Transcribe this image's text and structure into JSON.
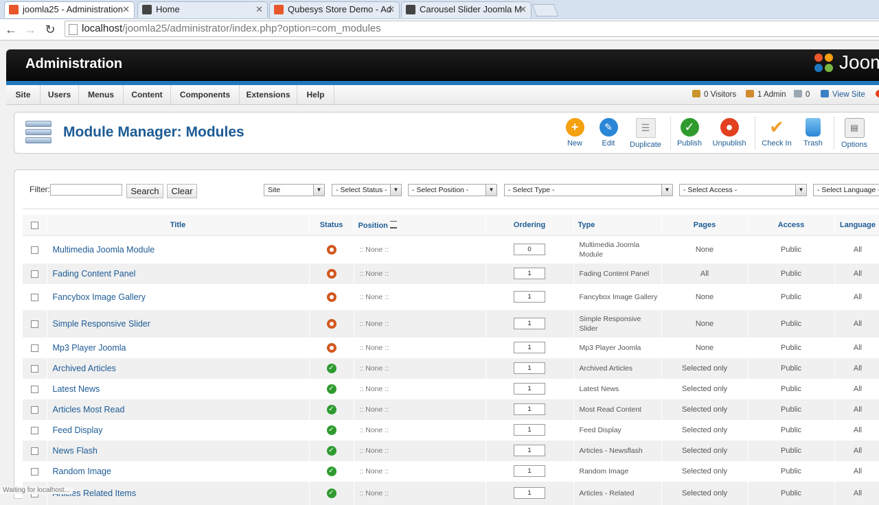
{
  "browser": {
    "tabs": [
      {
        "label": "joomla25 - Administration",
        "active": true
      },
      {
        "label": "Home",
        "active": false
      },
      {
        "label": "Qubesys Store Demo - Ad",
        "active": false
      },
      {
        "label": "Carousel Slider Joomla M",
        "active": false
      }
    ],
    "url_host": "localhost",
    "url_path": "/joomla25/administrator/index.php?option=com_modules",
    "status": "Waiting for localhost..."
  },
  "header": {
    "title": "Administration",
    "logo_text": "Joom"
  },
  "menu": [
    "Site",
    "Users",
    "Menus",
    "Content",
    "Components",
    "Extensions",
    "Help"
  ],
  "status_bar": {
    "visitors": "0 Visitors",
    "admins": "1 Admin",
    "messages": "0",
    "view_site": "View Site"
  },
  "page": {
    "title": "Module Manager: Modules"
  },
  "toolbar": [
    {
      "label": "New",
      "icon": "plus-icon",
      "color": "#f5a00f"
    },
    {
      "label": "Edit",
      "icon": "pencil-icon",
      "color": "#2a86d6"
    },
    {
      "label": "Duplicate",
      "icon": "document-copy-icon",
      "color": "#e6e6e6"
    },
    {
      "label": "Publish",
      "icon": "check-icon",
      "color": "#2f9b2f"
    },
    {
      "label": "Unpublish",
      "icon": "stop-icon",
      "color": "#e2401f"
    },
    {
      "label": "Check In",
      "icon": "checkmark-icon",
      "color": "#f0a030"
    },
    {
      "label": "Trash",
      "icon": "trash-icon",
      "color": "#3b9ee0"
    },
    {
      "label": "Options",
      "icon": "options-icon",
      "color": "#e6e6e6"
    }
  ],
  "filters": {
    "label": "Filter:",
    "search_value": "",
    "search_button": "Search",
    "clear_button": "Clear",
    "selects": [
      "Site",
      "- Select Status -",
      "- Select Position -",
      "- Select Type -",
      "- Select Access -",
      "- Select Language -"
    ]
  },
  "table": {
    "headers": [
      "Title",
      "Status",
      "Position",
      "Ordering",
      "Type",
      "Pages",
      "Access",
      "Language"
    ],
    "rows": [
      {
        "title": "Multimedia Joomla Module",
        "status": "unpublished",
        "position": ":: None ::",
        "ordering": "0",
        "type": "Multimedia Joomla Module",
        "pages": "None",
        "access": "Public",
        "language": "All"
      },
      {
        "title": "Fading Content Panel",
        "status": "unpublished",
        "position": ":: None ::",
        "ordering": "1",
        "type": "Fading Content Panel",
        "pages": "All",
        "access": "Public",
        "language": "All"
      },
      {
        "title": "Fancybox Image Gallery",
        "status": "unpublished",
        "position": ":: None ::",
        "ordering": "1",
        "type": "Fancybox Image Gallery",
        "pages": "None",
        "access": "Public",
        "language": "All"
      },
      {
        "title": "Simple Responsive Slider",
        "status": "unpublished",
        "position": ":: None ::",
        "ordering": "1",
        "type": "Simple Responsive Slider",
        "pages": "None",
        "access": "Public",
        "language": "All"
      },
      {
        "title": "Mp3 Player Joomla",
        "status": "unpublished",
        "position": ":: None ::",
        "ordering": "1",
        "type": "Mp3 Player Joomla",
        "pages": "None",
        "access": "Public",
        "language": "All"
      },
      {
        "title": "Archived Articles",
        "status": "published",
        "position": ":: None ::",
        "ordering": "1",
        "type": "Archived Articles",
        "pages": "Selected only",
        "access": "Public",
        "language": "All"
      },
      {
        "title": "Latest News",
        "status": "published",
        "position": ":: None ::",
        "ordering": "1",
        "type": "Latest News",
        "pages": "Selected only",
        "access": "Public",
        "language": "All"
      },
      {
        "title": "Articles Most Read",
        "status": "published",
        "position": ":: None ::",
        "ordering": "1",
        "type": "Most Read Content",
        "pages": "Selected only",
        "access": "Public",
        "language": "All"
      },
      {
        "title": "Feed Display",
        "status": "published",
        "position": ":: None ::",
        "ordering": "1",
        "type": "Feed Display",
        "pages": "Selected only",
        "access": "Public",
        "language": "All"
      },
      {
        "title": "News Flash",
        "status": "published",
        "position": ":: None ::",
        "ordering": "1",
        "type": "Articles - Newsflash",
        "pages": "Selected only",
        "access": "Public",
        "language": "All"
      },
      {
        "title": "Random Image",
        "status": "published",
        "position": ":: None ::",
        "ordering": "1",
        "type": "Random Image",
        "pages": "Selected only",
        "access": "Public",
        "language": "All"
      },
      {
        "title": "Articles Related Items",
        "status": "published",
        "position": ":: None ::",
        "ordering": "1",
        "type": "Articles - Related",
        "pages": "Selected only",
        "access": "Public",
        "language": "All"
      }
    ]
  }
}
